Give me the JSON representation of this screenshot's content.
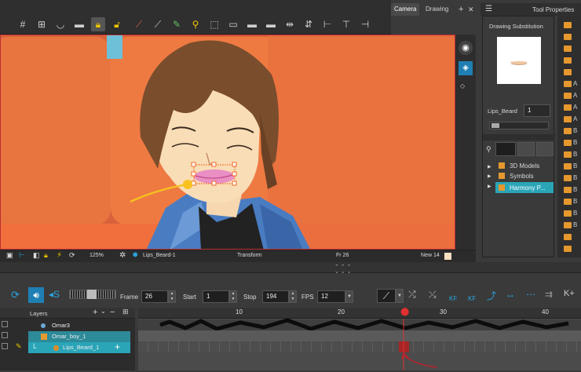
{
  "view_tabs": {
    "camera": "Camera",
    "drawing": "Drawing"
  },
  "tool_properties": {
    "title": "Tool Properties",
    "drawing_substitution": "Drawing Substitution",
    "drawing_name": "Lips_Beard",
    "drawing_value": "1",
    "tree": [
      "3D Models",
      "Symbols",
      "Harmony P..."
    ]
  },
  "right_strip_letters": [
    "A",
    "A",
    "A",
    "A",
    "B",
    "B",
    "B",
    "B",
    "B",
    "B",
    "B",
    "B",
    "B"
  ],
  "viewport_status": {
    "zoom": "125%",
    "drawing": "Lips_Beard-1",
    "tool": "Transform",
    "frame": "Fr 26",
    "new": "New 14"
  },
  "timeline": {
    "frame_label": "Frame",
    "frame_value": "26",
    "start_label": "Start",
    "start_value": "1",
    "stop_label": "Stop",
    "stop_value": "194",
    "fps_label": "FPS",
    "fps_value": "12",
    "kf_labels": [
      "KF",
      "KF"
    ],
    "layers_title": "Layers",
    "layers": [
      "Omar3",
      "Omar_boy_1",
      "Lips_Beard_1"
    ],
    "ruler": [
      "10",
      "20",
      "30",
      "40"
    ]
  }
}
